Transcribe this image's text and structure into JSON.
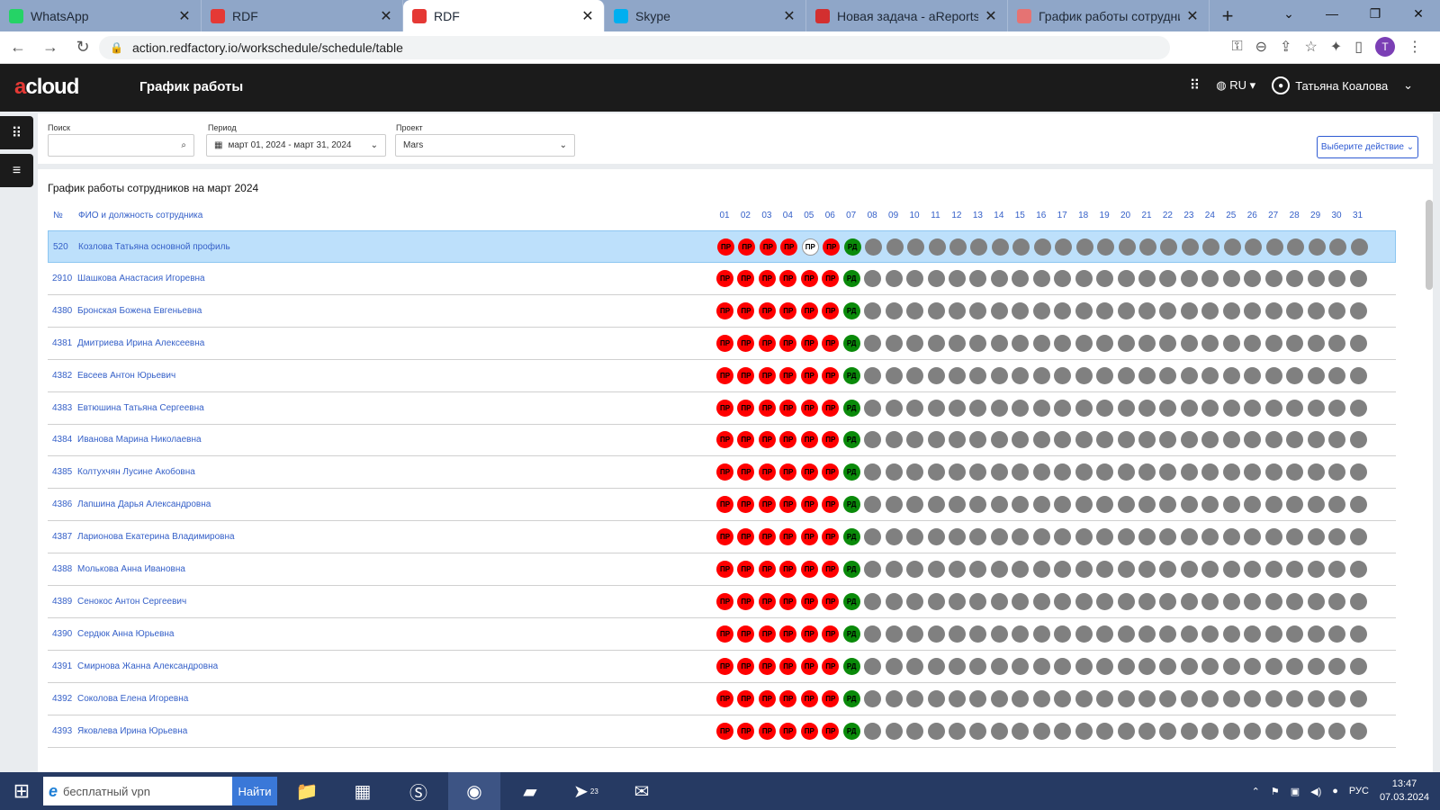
{
  "browser": {
    "tabs": [
      {
        "label": "WhatsApp",
        "icon": "whatsapp-icon",
        "color": "#25d366"
      },
      {
        "label": "RDF",
        "icon": "rdf-icon",
        "color": "#e53935"
      },
      {
        "label": "RDF",
        "icon": "rdf-icon",
        "color": "#e53935",
        "active": true
      },
      {
        "label": "Skype",
        "icon": "skype-icon",
        "color": "#00aff0"
      },
      {
        "label": "Новая задача - aReports - SU",
        "icon": "areports-icon",
        "color": "#d32f2f"
      },
      {
        "label": "График работы сотрудника | A",
        "icon": "page-icon",
        "color": "#e57373"
      }
    ],
    "url": "action.redfactory.io/workschedule/schedule/table",
    "profile_initial": "T"
  },
  "app": {
    "logo_prefix": "a",
    "logo_text": "cloud",
    "title": "График работы",
    "language": "RU",
    "user_name": "Татьяна Коалова"
  },
  "filters": {
    "search_label": "Поиск",
    "search_value": "",
    "period_label": "Период",
    "period_value": "март 01, 2024 - март 31, 2024",
    "project_label": "Проект",
    "project_value": "Mars",
    "action_button": "Выберите действие"
  },
  "table": {
    "title": "График работы сотрудников на март 2024",
    "col_no": "№",
    "col_name": "ФИО и должность сотрудника",
    "days": [
      "01",
      "02",
      "03",
      "04",
      "05",
      "06",
      "07",
      "08",
      "09",
      "10",
      "11",
      "12",
      "13",
      "14",
      "15",
      "16",
      "17",
      "18",
      "19",
      "20",
      "21",
      "22",
      "23",
      "24",
      "25",
      "26",
      "27",
      "28",
      "29",
      "30",
      "31"
    ],
    "status_labels": {
      "pr": "ПР",
      "rd": "РД"
    },
    "rows": [
      {
        "id": "520",
        "name": "Козлова Татьяна основной профиль",
        "selected": true
      },
      {
        "id": "2910",
        "name": "Шашкова Анастасия Игоревна"
      },
      {
        "id": "4380",
        "name": "Бронская Божена Евгеньевна"
      },
      {
        "id": "4381",
        "name": "Дмитриева Ирина Алексеевна"
      },
      {
        "id": "4382",
        "name": "Евсеев Антон Юрьевич"
      },
      {
        "id": "4383",
        "name": "Евтюшина Татьяна Сергеевна"
      },
      {
        "id": "4384",
        "name": "Иванова Марина Николаевна"
      },
      {
        "id": "4385",
        "name": "Колтухчян Лусине Акобовна"
      },
      {
        "id": "4386",
        "name": "Лапшина Дарья Александровна"
      },
      {
        "id": "4387",
        "name": "Ларионова Екатерина Владимировна"
      },
      {
        "id": "4388",
        "name": "Молькова Анна Ивановна"
      },
      {
        "id": "4389",
        "name": "Сенокос Антон Сергеевич"
      },
      {
        "id": "4390",
        "name": "Сердюк Анна Юрьевна"
      },
      {
        "id": "4391",
        "name": "Смирнова Жанна Александровна"
      },
      {
        "id": "4392",
        "name": "Соколова Елена Игоревна"
      },
      {
        "id": "4393",
        "name": "Яковлева Ирина Юрьевна"
      }
    ]
  },
  "taskbar": {
    "search_placeholder": "бесплатный vpn",
    "search_button": "Найти",
    "language": "РУС",
    "time": "13:47",
    "date": "07.03.2024",
    "telegram_badge": "23"
  }
}
